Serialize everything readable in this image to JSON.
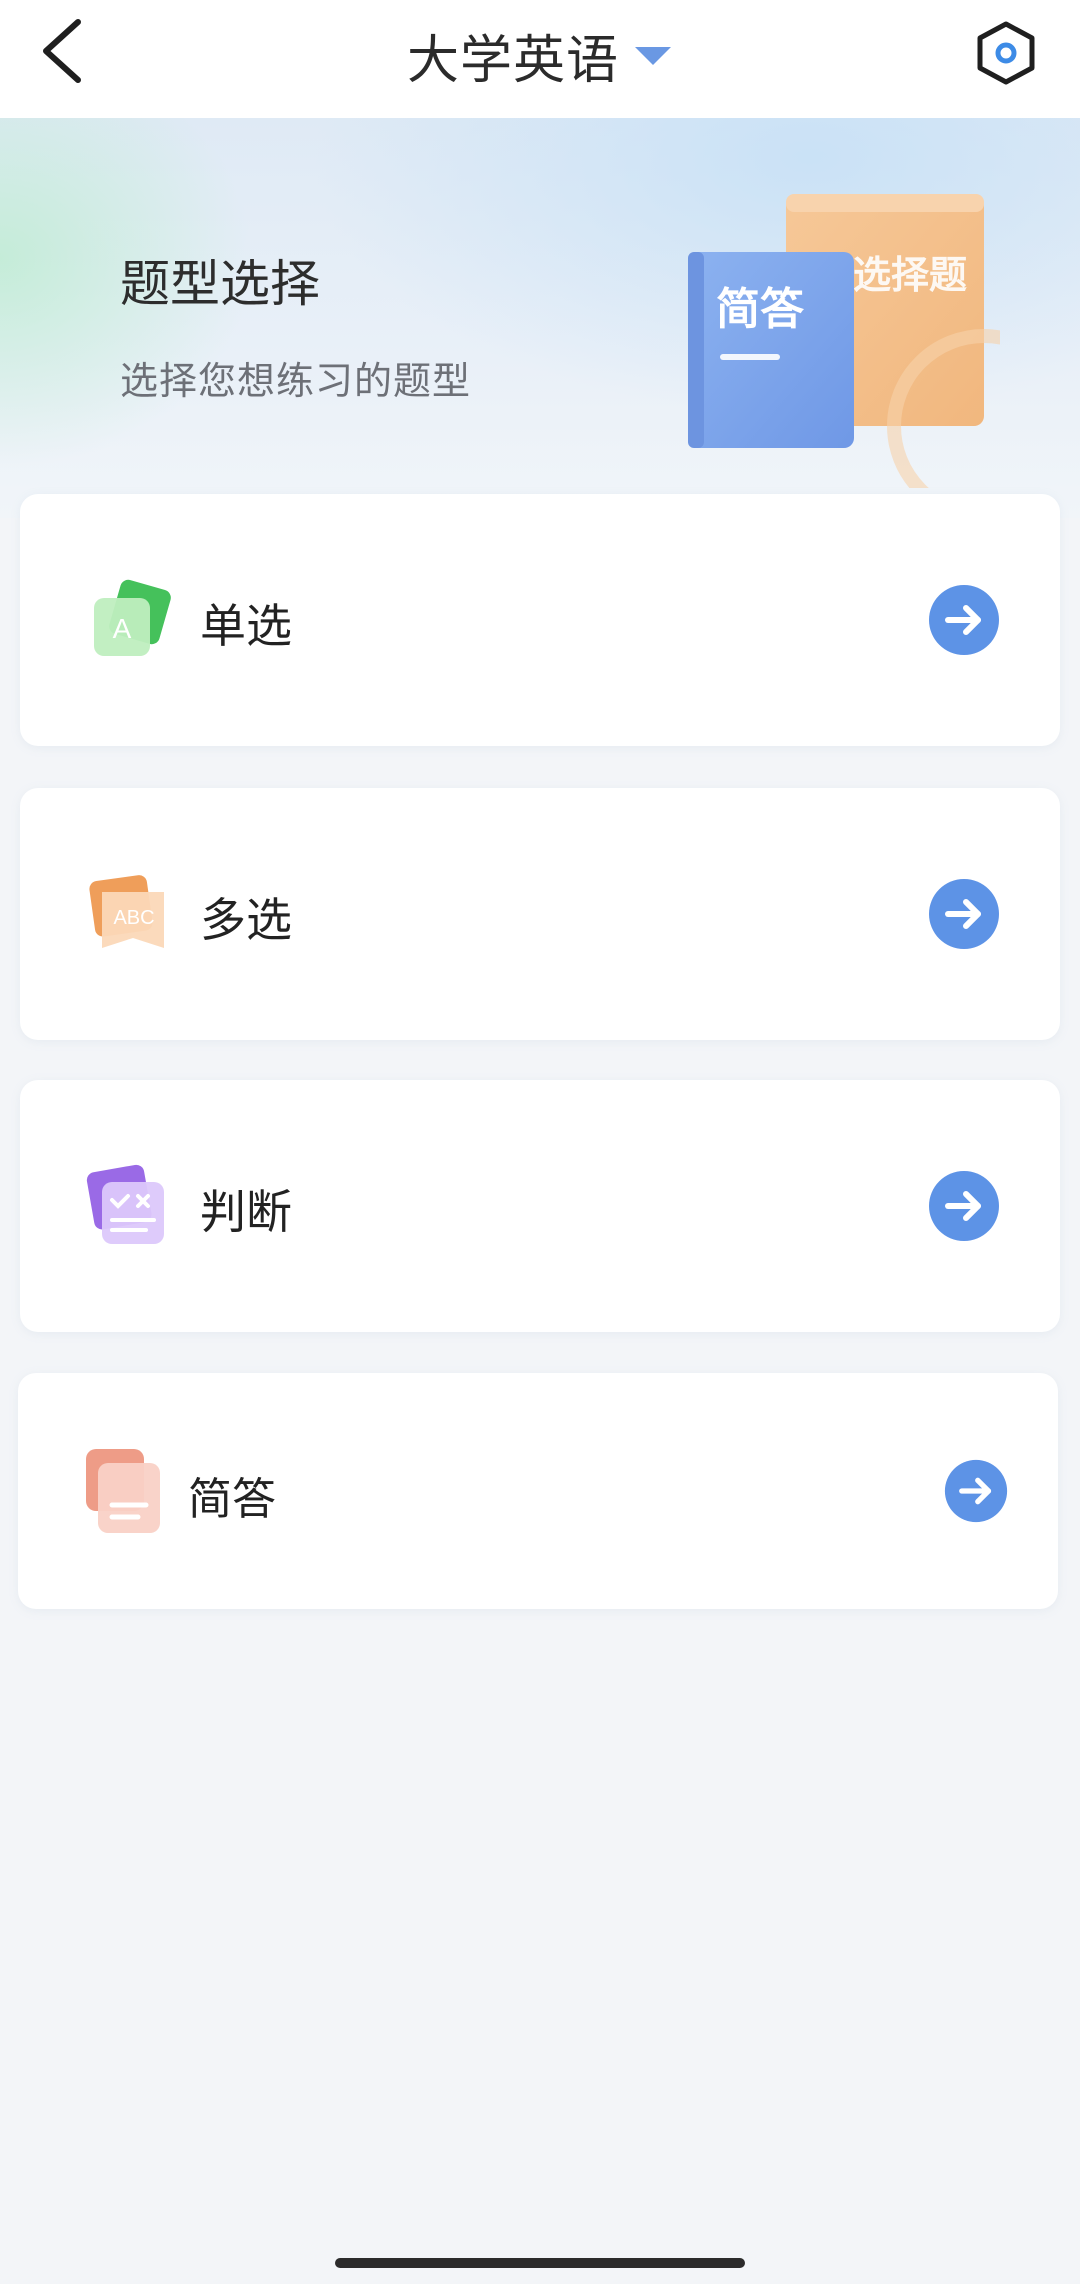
{
  "header": {
    "back_icon": "chevron-left-icon",
    "title": "大学英语",
    "dropdown_icon": "caret-down-icon",
    "settings_icon": "hexagon-settings-icon"
  },
  "hero": {
    "title": "题型选择",
    "subtitle": "选择您想练习的题型",
    "illustration": {
      "front_book_label": "简答",
      "back_book_label": "选择题"
    }
  },
  "question_types": [
    {
      "label": "单选",
      "icon": "single-choice-icon",
      "icon_text": "A"
    },
    {
      "label": "多选",
      "icon": "multiple-choice-icon",
      "icon_text": "ABC"
    },
    {
      "label": "判断",
      "icon": "true-false-icon"
    },
    {
      "label": "简答",
      "icon": "short-answer-icon"
    }
  ],
  "colors": {
    "accent": "#5d93e6",
    "book_blue": "#7ea6ec",
    "book_orange": "#f3c08c"
  }
}
